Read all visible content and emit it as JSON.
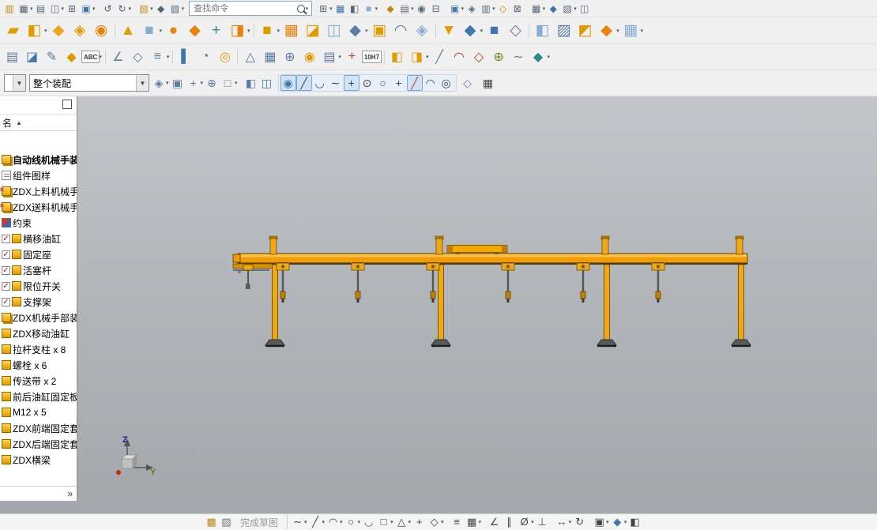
{
  "toolbar": {
    "search": {
      "placeholder": "查找命令"
    },
    "row0_left": [
      {
        "g": "▥",
        "c": "#c08a10"
      },
      {
        "g": "▦",
        "c": "#55687a",
        "dd": true
      },
      {
        "g": "▤",
        "c": "#55687a"
      },
      {
        "g": "◫",
        "c": "#55687a",
        "dd": true
      },
      {
        "g": "⊞",
        "c": "#55687a"
      },
      {
        "g": "▣",
        "c": "#3f77ad",
        "dd": true
      },
      {
        "sep": true
      },
      {
        "g": "↺",
        "c": "#4a5a6a"
      },
      {
        "g": "↻",
        "c": "#4a5a6a",
        "dd": true
      },
      {
        "sep": true
      },
      {
        "g": "▧",
        "c": "#c08a10",
        "dd": true
      },
      {
        "g": "◆",
        "c": "#55687a"
      },
      {
        "g": "▨",
        "c": "#55687a",
        "dd": true
      }
    ],
    "row0_right": [
      {
        "g": "⊞",
        "c": "#55687a",
        "dd": true
      },
      {
        "g": "▦",
        "c": "#3f77ad"
      },
      {
        "g": "◧",
        "c": "#55687a"
      },
      {
        "g": "■",
        "c": "#85add6",
        "dd": true
      },
      {
        "sep": true
      },
      {
        "g": "◆",
        "c": "#c08a10"
      },
      {
        "g": "▤",
        "c": "#55687a",
        "dd": true
      },
      {
        "g": "◉",
        "c": "#55687a"
      },
      {
        "g": "⊟",
        "c": "#55687a"
      },
      {
        "sep": true
      },
      {
        "g": "▣",
        "c": "#3f77ad",
        "dd": true
      },
      {
        "g": "◈",
        "c": "#55687a"
      },
      {
        "g": "▥",
        "c": "#55687a",
        "dd": true
      },
      {
        "g": "◇",
        "c": "#c08a10"
      },
      {
        "g": "⊠",
        "c": "#55687a"
      },
      {
        "sep": true
      },
      {
        "g": "▦",
        "c": "#55687a",
        "dd": true
      },
      {
        "g": "◆",
        "c": "#3f77ad"
      },
      {
        "g": "▧",
        "c": "#55687a",
        "dd": true
      },
      {
        "g": "◫",
        "c": "#55687a"
      }
    ],
    "row1": [
      {
        "g": "▰",
        "c": "#e09b00"
      },
      {
        "g": "◧",
        "c": "#e09b00",
        "dd": true
      },
      {
        "g": "◆",
        "c": "#e8a81e"
      },
      {
        "g": "◈",
        "c": "#e09b00"
      },
      {
        "g": "◉",
        "c": "#e8830a"
      },
      {
        "sep": true
      },
      {
        "g": "▲",
        "c": "#e09b00"
      },
      {
        "g": "■",
        "c": "#85add6",
        "dd": true
      },
      {
        "g": "●",
        "c": "#e8830a"
      },
      {
        "g": "◆",
        "c": "#e8830a"
      },
      {
        "g": "+",
        "c": "#2e8b8b"
      },
      {
        "g": "◨",
        "c": "#e8830a",
        "dd": true
      },
      {
        "sep": true
      },
      {
        "g": "■",
        "c": "#e09b00",
        "dd": true
      },
      {
        "g": "▦",
        "c": "#e8830a"
      },
      {
        "g": "◪",
        "c": "#e09b00"
      },
      {
        "g": "◫",
        "c": "#85add6"
      },
      {
        "g": "◆",
        "c": "#5c7da0",
        "dd": true
      },
      {
        "g": "▣",
        "c": "#e09b00"
      },
      {
        "g": "◠",
        "c": "#5c7da0"
      },
      {
        "g": "◈",
        "c": "#85add6"
      },
      {
        "sep": true
      },
      {
        "g": "▼",
        "c": "#e09b00"
      },
      {
        "g": "◆",
        "c": "#3f77ad",
        "dd": true
      },
      {
        "g": "■",
        "c": "#3f77ad"
      },
      {
        "g": "◇",
        "c": "#5c7da0"
      },
      {
        "sep": true
      },
      {
        "g": "◧",
        "c": "#85add6"
      },
      {
        "g": "▨",
        "c": "#5c7da0"
      },
      {
        "g": "◩",
        "c": "#e09b00"
      },
      {
        "g": "◆",
        "c": "#e8830a",
        "dd": true
      },
      {
        "g": "▦",
        "c": "#85add6",
        "dd": true
      }
    ],
    "row2": [
      {
        "g": "▤",
        "c": "#5c7da0"
      },
      {
        "g": "◪",
        "c": "#3f77ad"
      },
      {
        "g": "✎",
        "c": "#5c7da0"
      },
      {
        "g": "◆",
        "c": "#e09b00"
      },
      {
        "g": "ABC",
        "text": true,
        "dd": true
      },
      {
        "sep": true
      },
      {
        "g": "∠",
        "c": "#5c7da0"
      },
      {
        "g": "◇",
        "c": "#5c7da0"
      },
      {
        "g": "≡",
        "c": "#5c7da0",
        "dd": true
      },
      {
        "sep": true
      },
      {
        "g": "▌",
        "c": "#3f77ad"
      },
      {
        "g": "◔",
        "c": "#5c7da0"
      },
      {
        "g": "◎",
        "c": "#e09b00"
      },
      {
        "sep": true
      },
      {
        "g": "△",
        "c": "#5c7da0"
      },
      {
        "g": "▦",
        "c": "#5c7da0"
      },
      {
        "g": "⊕",
        "c": "#5c7da0"
      },
      {
        "g": "◉",
        "c": "#e09b00"
      },
      {
        "g": "▤",
        "c": "#5c7da0",
        "dd": true
      },
      {
        "g": "+",
        "c": "#c23b22"
      },
      {
        "g": "10H7",
        "text": true
      },
      {
        "sep": true
      },
      {
        "g": "◧",
        "c": "#e09b00"
      },
      {
        "g": "◨",
        "c": "#e09b00",
        "dd": true
      },
      {
        "g": "╱",
        "c": "#5c7da0"
      },
      {
        "g": "◠",
        "c": "#c23b22"
      },
      {
        "g": "◇",
        "c": "#c23b22"
      },
      {
        "g": "⊕",
        "c": "#6b8e23"
      },
      {
        "g": "∼",
        "c": "#5c7da0"
      },
      {
        "g": "◆",
        "c": "#2e8b8b",
        "dd": true
      }
    ]
  },
  "selection_bar": {
    "filter_value": "",
    "scope_value": "整个装配",
    "pre": [
      {
        "g": "◈",
        "c": "#5c7da0",
        "dd": true
      },
      {
        "g": "▣",
        "c": "#5c7da0"
      },
      {
        "g": "+",
        "c": "#5c7da0",
        "dd": true
      },
      {
        "g": "⊕",
        "c": "#5c7da0"
      },
      {
        "g": "□",
        "c": "#5c7da0",
        "dd": true
      },
      {
        "sep": true
      },
      {
        "g": "◧",
        "c": "#5c7da0"
      },
      {
        "g": "◫",
        "c": "#3f77ad"
      }
    ],
    "snap": [
      {
        "g": "◉",
        "c": "#3f77ad",
        "active": true
      },
      {
        "g": "╱",
        "c": "#444",
        "active": true
      },
      {
        "g": "◡",
        "c": "#444"
      },
      {
        "g": "∼",
        "c": "#444"
      },
      {
        "g": "+",
        "c": "#444",
        "active": true
      },
      {
        "g": "⊙",
        "c": "#444"
      },
      {
        "g": "○",
        "c": "#444"
      },
      {
        "g": "+",
        "c": "#444"
      },
      {
        "g": "╱",
        "c": "#c23b22",
        "active": true
      },
      {
        "g": "◠",
        "c": "#444"
      },
      {
        "g": "◎",
        "c": "#444"
      }
    ],
    "post": [
      {
        "g": "◇",
        "c": "#5c7da0"
      },
      {
        "sep": true
      },
      {
        "g": "▦",
        "c": "#444"
      }
    ]
  },
  "sidebar": {
    "header": "名",
    "items": [
      {
        "label": "自动线机械手装配",
        "icon": "asm",
        "bold": true
      },
      {
        "label": "组件图样",
        "icon": "sheet"
      },
      {
        "label": "ZDX上料机械手",
        "icon": "asm",
        "mark": true
      },
      {
        "label": "ZDX送料机械手",
        "icon": "asm",
        "mark": true
      },
      {
        "label": "约束",
        "icon": "constraint"
      },
      {
        "label": "横移油缸",
        "icon": "part",
        "checked": true
      },
      {
        "label": "固定座",
        "icon": "part",
        "checked": true
      },
      {
        "label": "活塞杆",
        "icon": "part",
        "checked": true
      },
      {
        "label": "限位开关",
        "icon": "part",
        "checked": true
      },
      {
        "label": "支撑架",
        "icon": "part",
        "checked": true
      },
      {
        "label": "ZDX机械手部装",
        "icon": "asm"
      },
      {
        "label": "ZDX移动油缸",
        "icon": "part"
      },
      {
        "label": "拉杆支柱 x 8",
        "icon": "part"
      },
      {
        "label": "螺栓 x 6",
        "icon": "part"
      },
      {
        "label": "传送带 x 2",
        "icon": "part"
      },
      {
        "label": "前后油缸固定板",
        "icon": "part"
      },
      {
        "label": "M12 x 5",
        "icon": "part"
      },
      {
        "label": "ZDX前端固定套",
        "icon": "part"
      },
      {
        "label": "ZDX后端固定套",
        "icon": "part"
      },
      {
        "label": "ZDX横梁",
        "icon": "part"
      }
    ]
  },
  "viewport": {
    "triad": {
      "z": "Z",
      "y": "Y"
    },
    "colors": {
      "machine_orange": "#f09d00",
      "bg_top": "#c2c5c9",
      "bg_bottom": "#a4a7ab"
    }
  },
  "bottom_bar": {
    "finish_label": "完成草图",
    "icons_left": [
      {
        "g": "▩",
        "c": "#c08a10"
      },
      {
        "g": "▨",
        "c": "#777777"
      }
    ],
    "icons_right": [
      {
        "g": "∼",
        "c": "#444",
        "dd": true
      },
      {
        "g": "╱",
        "c": "#444",
        "dd": true
      },
      {
        "g": "◠",
        "c": "#444",
        "dd": true
      },
      {
        "g": "○",
        "c": "#444",
        "dd": true
      },
      {
        "g": "◡",
        "c": "#444"
      },
      {
        "g": "□",
        "c": "#444",
        "dd": true
      },
      {
        "g": "△",
        "c": "#444",
        "dd": true
      },
      {
        "g": "+",
        "c": "#444"
      },
      {
        "g": "◇",
        "c": "#444",
        "dd": true
      },
      {
        "sep": true
      },
      {
        "g": "≡",
        "c": "#444"
      },
      {
        "g": "▦",
        "c": "#444",
        "dd": true
      },
      {
        "sep": true
      },
      {
        "g": "∠",
        "c": "#444"
      },
      {
        "g": "∥",
        "c": "#444"
      },
      {
        "g": "Ø",
        "c": "#444",
        "dd": true
      },
      {
        "g": "⊥",
        "c": "#444"
      },
      {
        "sep": true
      },
      {
        "g": "↔",
        "c": "#444",
        "dd": true
      },
      {
        "g": "↻",
        "c": "#444"
      },
      {
        "sep": true
      },
      {
        "g": "▣",
        "c": "#444",
        "dd": true
      },
      {
        "g": "◆",
        "c": "#3f77ad",
        "dd": true
      },
      {
        "g": "◧",
        "c": "#444"
      }
    ]
  }
}
